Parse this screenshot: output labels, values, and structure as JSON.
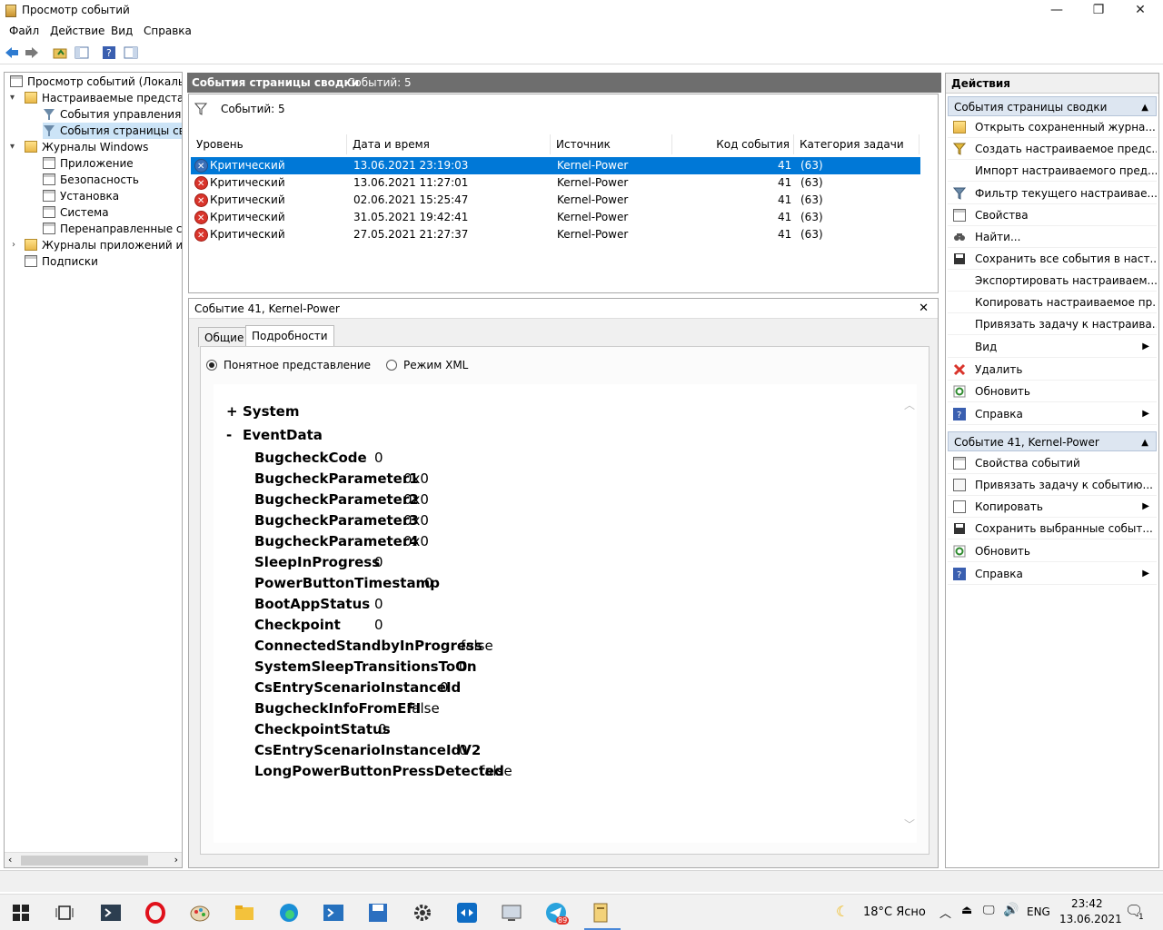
{
  "window": {
    "title": "Просмотр событий",
    "minimize": "—",
    "maximize": "❐",
    "close": "✕"
  },
  "menu": [
    "Файл",
    "Действие",
    "Вид",
    "Справка"
  ],
  "tree": {
    "items": [
      {
        "label": "Просмотр событий (Локальны"
      },
      {
        "label": "Настраиваемые представле"
      },
      {
        "label": "События управления"
      },
      {
        "label": "События страницы свод"
      },
      {
        "label": "Журналы Windows"
      },
      {
        "label": "Приложение"
      },
      {
        "label": "Безопасность"
      },
      {
        "label": "Установка"
      },
      {
        "label": "Система"
      },
      {
        "label": "Перенаправленные соб"
      },
      {
        "label": "Журналы приложений и сл"
      },
      {
        "label": "Подписки"
      }
    ]
  },
  "center": {
    "header_title": "События страницы сводки",
    "header_count": "Событий: 5",
    "filter_text": "Событий: 5",
    "columns": [
      "Уровень",
      "Дата и время",
      "Источник",
      "Код события",
      "Категория задачи"
    ],
    "rows": [
      {
        "level": "Критический",
        "date": "13.06.2021 23:19:03",
        "source": "Kernel-Power",
        "code": "41",
        "category": "(63)"
      },
      {
        "level": "Критический",
        "date": "13.06.2021 11:27:01",
        "source": "Kernel-Power",
        "code": "41",
        "category": "(63)"
      },
      {
        "level": "Критический",
        "date": "02.06.2021 15:25:47",
        "source": "Kernel-Power",
        "code": "41",
        "category": "(63)"
      },
      {
        "level": "Критический",
        "date": "31.05.2021 19:42:41",
        "source": "Kernel-Power",
        "code": "41",
        "category": "(63)"
      },
      {
        "level": "Критический",
        "date": "27.05.2021 21:27:37",
        "source": "Kernel-Power",
        "code": "41",
        "category": "(63)"
      }
    ]
  },
  "detail": {
    "title": "Событие 41, Kernel-Power",
    "close": "✕",
    "tabs": [
      "Общие",
      "Подробности"
    ],
    "radio_friendly": "Понятное представление",
    "radio_xml": "Режим XML",
    "system_toggle": "+",
    "system_label": "System",
    "eventdata_toggle": "-",
    "eventdata_label": "EventData",
    "fields": [
      {
        "name": "BugcheckCode",
        "value": "0"
      },
      {
        "name": "BugcheckParameter1",
        "value": "0x0"
      },
      {
        "name": "BugcheckParameter2",
        "value": "0x0"
      },
      {
        "name": "BugcheckParameter3",
        "value": "0x0"
      },
      {
        "name": "BugcheckParameter4",
        "value": "0x0"
      },
      {
        "name": "SleepInProgress",
        "value": "0"
      },
      {
        "name": "PowerButtonTimestamp",
        "value": "0"
      },
      {
        "name": "BootAppStatus",
        "value": "0"
      },
      {
        "name": "Checkpoint",
        "value": "0"
      },
      {
        "name": "ConnectedStandbyInProgress",
        "value": "false"
      },
      {
        "name": "SystemSleepTransitionsToOn",
        "value": "0"
      },
      {
        "name": "CsEntryScenarioInstanceId",
        "value": "0"
      },
      {
        "name": "BugcheckInfoFromEFI",
        "value": "false"
      },
      {
        "name": "CheckpointStatus",
        "value": "0"
      },
      {
        "name": "CsEntryScenarioInstanceIdV2",
        "value": "0"
      },
      {
        "name": "LongPowerButtonPressDetected",
        "value": "false"
      }
    ]
  },
  "actions": {
    "title": "Действия",
    "section1": "События страницы сводки",
    "section1_items": [
      {
        "label": "Открыть сохраненный журна...",
        "icon": "open-folder-icon"
      },
      {
        "label": "Создать настраиваемое предс...",
        "icon": "create-filter-icon"
      },
      {
        "label": "Импорт настраиваемого пред...",
        "icon": ""
      },
      {
        "label": "Фильтр текущего настраивае...",
        "icon": "filter-icon"
      },
      {
        "label": "Свойства",
        "icon": "properties-icon"
      },
      {
        "label": "Найти...",
        "icon": "find-icon"
      },
      {
        "label": "Сохранить все события в наст...",
        "icon": "save-icon"
      },
      {
        "label": "Экспортировать настраиваем...",
        "icon": ""
      },
      {
        "label": "Копировать настраиваемое пр...",
        "icon": ""
      },
      {
        "label": "Привязать задачу к настраива...",
        "icon": ""
      },
      {
        "label": "Вид",
        "icon": "",
        "submenu": true
      },
      {
        "label": "Удалить",
        "icon": "delete-icon"
      },
      {
        "label": "Обновить",
        "icon": "refresh-icon"
      },
      {
        "label": "Справка",
        "icon": "help-icon",
        "submenu": true
      }
    ],
    "section2": "Событие 41, Kernel-Power",
    "section2_items": [
      {
        "label": "Свойства событий",
        "icon": "properties-icon"
      },
      {
        "label": "Привязать задачу к событию...",
        "icon": "task-icon"
      },
      {
        "label": "Копировать",
        "icon": "copy-icon",
        "submenu": true
      },
      {
        "label": "Сохранить выбранные событ...",
        "icon": "save-icon"
      },
      {
        "label": "Обновить",
        "icon": "refresh-icon"
      },
      {
        "label": "Справка",
        "icon": "help-icon",
        "submenu": true
      }
    ]
  },
  "taskbar": {
    "weather": "18°C  Ясно",
    "lang": "ENG",
    "time": "23:42",
    "date": "13.06.2021",
    "telegram_badge": "89",
    "notification_count": "1"
  },
  "colors": {
    "selection": "#0078d7",
    "header_gray": "#6e6e6e",
    "error_red": "#d9342b"
  }
}
